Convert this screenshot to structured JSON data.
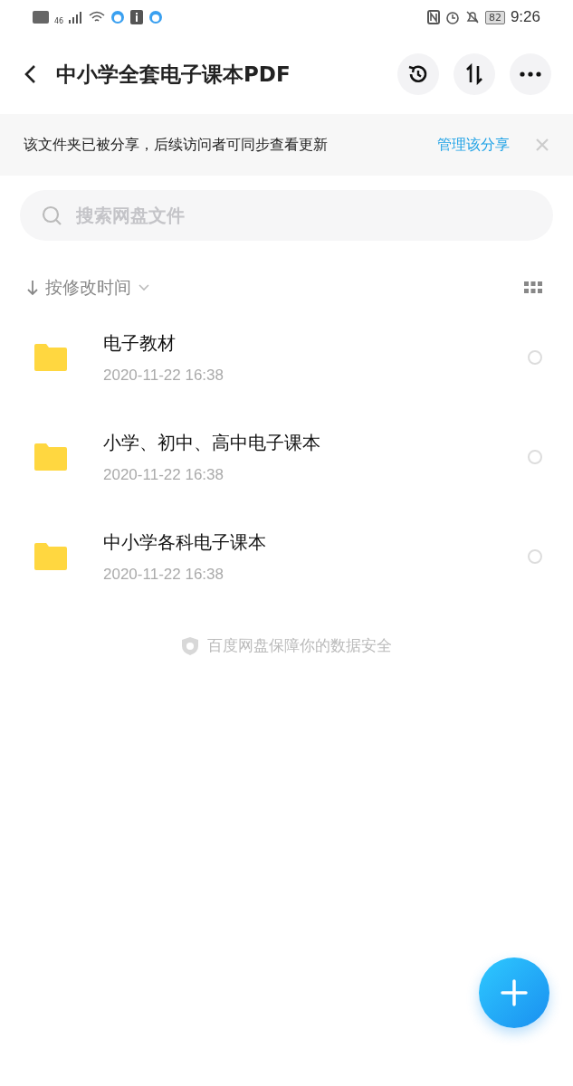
{
  "status_bar": {
    "network": "46",
    "battery": "82",
    "time": "9:26"
  },
  "header": {
    "title": "中小学全套电子课本PDF"
  },
  "share_banner": {
    "message": "该文件夹已被分享，后续访问者可同步查看更新",
    "link": "管理该分享"
  },
  "search": {
    "placeholder": "搜索网盘文件"
  },
  "sort": {
    "label": "按修改时间"
  },
  "files": [
    {
      "name": "电子教材",
      "date": "2020-11-22  16:38",
      "selected": false
    },
    {
      "name": "小学、初中、高中电子课本",
      "date": "2020-11-22  16:38",
      "selected": false
    },
    {
      "name": "中小学各科电子课本",
      "date": "2020-11-22  16:38",
      "selected": false
    }
  ],
  "footer": {
    "note": "百度网盘保障你的数据安全"
  }
}
